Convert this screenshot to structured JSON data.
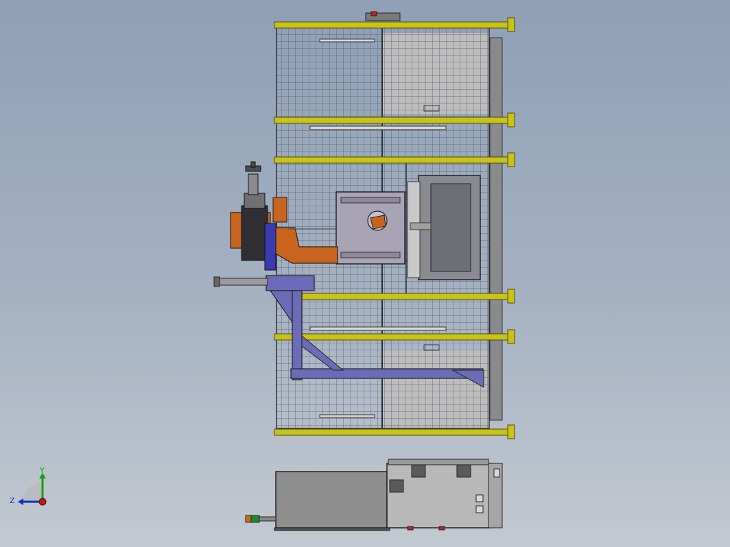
{
  "viewport": {
    "background_top": "#8f9fb6",
    "background_bottom": "#c3c9d1"
  },
  "colors": {
    "frame_yellow": "#c9c317",
    "mesh": "#4a4f59",
    "panel_gray": "#b9b9b9",
    "robot_orange": "#c8641e",
    "robot_base_blue": "#6b6bb8",
    "robot_dark": "#2e2e33",
    "fixture_gray": "#8a8a92",
    "cabinet_gray": "#8e8e8e",
    "controller_gray": "#b8b8b8",
    "axis_x": "#d01010",
    "axis_y": "#10a010",
    "axis_z": "#1030c0"
  },
  "triad": {
    "y_label": "Y",
    "z_label": "Z"
  },
  "components": [
    "safety-fence",
    "welding-robot",
    "robot-base",
    "workpiece-fixture",
    "positioner",
    "control-cabinet",
    "robot-controller",
    "signal-tower-light"
  ]
}
